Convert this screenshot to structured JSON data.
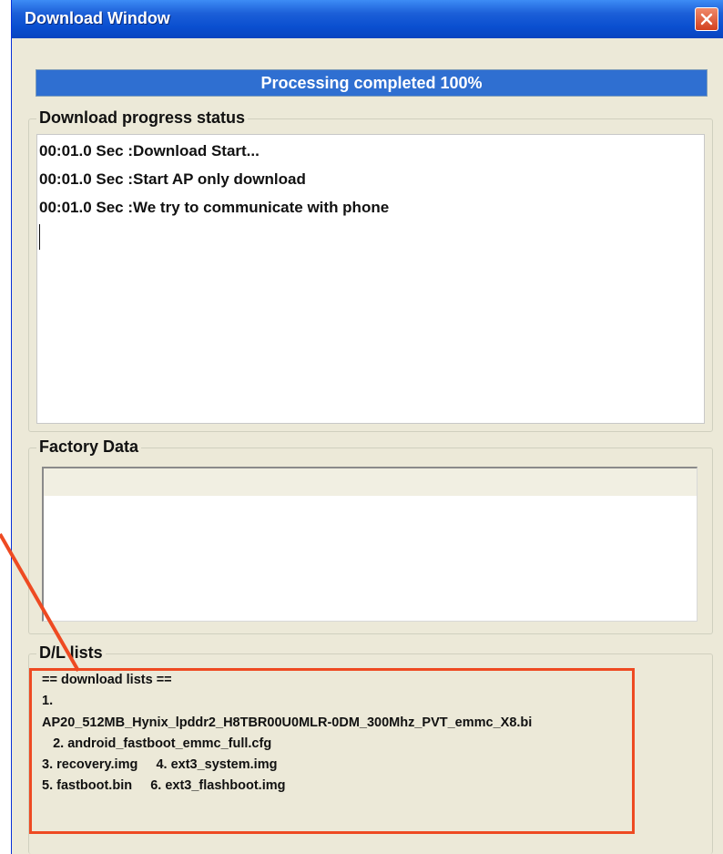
{
  "window": {
    "title": "Download Window",
    "close_icon": "close-icon"
  },
  "progress": {
    "text": "Processing completed 100%",
    "percent": 100,
    "fill_color": "#2f6fd1"
  },
  "status_group": {
    "label": "Download progress status",
    "lines": [
      "00:01.0 Sec  :Download Start...",
      "00:01.0 Sec  :Start AP only download",
      "00:01.0 Sec  :We try to communicate with phone"
    ]
  },
  "factory_group": {
    "label": "Factory Data"
  },
  "dl_group": {
    "label": "D/L lists",
    "lines": [
      "==  download lists  ==",
      "1.",
      "AP20_512MB_Hynix_lpddr2_H8TBR00U0MLR-0DM_300Mhz_PVT_emmc_X8.bi",
      "   2. android_fastboot_emmc_full.cfg",
      "3. recovery.img     4. ext3_system.img",
      "5. fastboot.bin     6. ext3_flashboot.img"
    ]
  },
  "annotation": {
    "color": "#ee4a22"
  }
}
